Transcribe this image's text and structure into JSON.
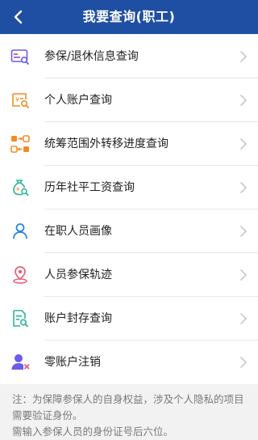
{
  "header": {
    "title": "我要查询(职工)",
    "back_icon": "back-arrow-icon"
  },
  "menu": [
    {
      "label": "参保/退休信息查询",
      "icon": "id-card-search-icon"
    },
    {
      "label": "个人账户查询",
      "icon": "yuan-account-search-icon"
    },
    {
      "label": "统筹范围外转移进度查询",
      "icon": "transfer-progress-icon"
    },
    {
      "label": "历年社平工资查询",
      "icon": "money-bag-search-icon"
    },
    {
      "label": "在职人员画像",
      "icon": "person-icon"
    },
    {
      "label": "人员参保轨迹",
      "icon": "location-track-icon"
    },
    {
      "label": "账户封存查询",
      "icon": "document-search-icon"
    },
    {
      "label": "零账户注销",
      "icon": "user-remove-icon"
    }
  ],
  "note": {
    "line1": "注：为保障参保人的自身权益，涉及个人隐私的项目需要验证身份。",
    "line2": "需输入参保人员的身份证号后六位。"
  },
  "colors": {
    "header": "#1f4fa3",
    "accent_purple": "#6c5ce7",
    "accent_orange": "#f08c28",
    "accent_green": "#2bb39a",
    "accent_blue": "#2a86d9",
    "accent_pink": "#e6607a"
  }
}
